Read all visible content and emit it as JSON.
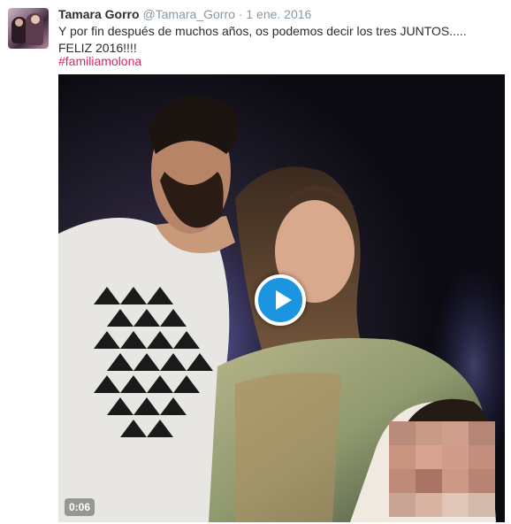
{
  "tweet": {
    "author_name": "Tamara Gorro",
    "author_handle": "@Tamara_Gorro",
    "separator": "·",
    "date": "1 ene. 2016",
    "text_line1": "Y por fin después de muchos años, os podemos decir los tres JUNTOS.....",
    "text_line2": "FELIZ 2016!!!!",
    "hashtag": "#familiamolona"
  },
  "video": {
    "duration": "0:06",
    "play_icon": "play-icon",
    "accent_color": "#1b95e0"
  },
  "colors": {
    "hashtag": "#e0245e",
    "meta_text": "#8899a6",
    "body_text": "#292f33"
  }
}
